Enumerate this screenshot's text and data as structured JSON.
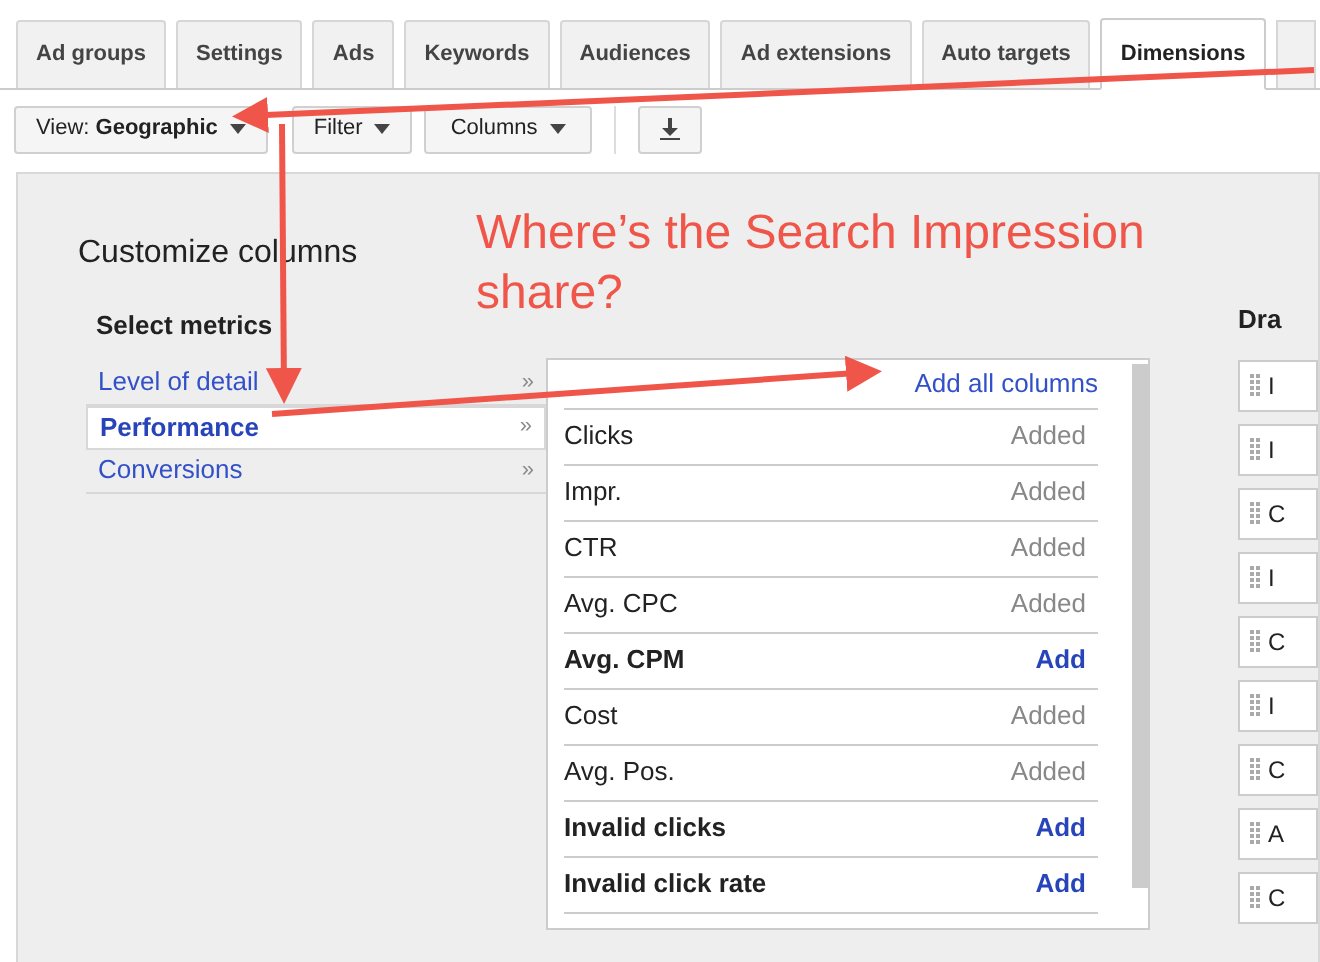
{
  "tabs": [
    {
      "label": "Ad groups",
      "selected": false
    },
    {
      "label": "Settings",
      "selected": false
    },
    {
      "label": "Ads",
      "selected": false
    },
    {
      "label": "Keywords",
      "selected": false
    },
    {
      "label": "Audiences",
      "selected": false
    },
    {
      "label": "Ad extensions",
      "selected": false
    },
    {
      "label": "Auto targets",
      "selected": false
    },
    {
      "label": "Dimensions",
      "selected": true
    }
  ],
  "toolbar": {
    "view_label": "View:",
    "view_value": "Geographic",
    "filter": "Filter",
    "columns": "Columns"
  },
  "panel": {
    "title": "Customize columns",
    "section_title": "Select metrics",
    "categories": [
      {
        "label": "Level of detail",
        "selected": false,
        "chevron": "»"
      },
      {
        "label": "Performance",
        "selected": true,
        "chevron": "»"
      },
      {
        "label": "Conversions",
        "selected": false,
        "chevron": "»"
      }
    ],
    "add_all": "Add all columns",
    "metrics": [
      {
        "name": "Clicks",
        "added": true,
        "action": "Added"
      },
      {
        "name": "Impr.",
        "added": true,
        "action": "Added"
      },
      {
        "name": "CTR",
        "added": true,
        "action": "Added"
      },
      {
        "name": "Avg. CPC",
        "added": true,
        "action": "Added"
      },
      {
        "name": "Avg. CPM",
        "added": false,
        "action": "Add"
      },
      {
        "name": "Cost",
        "added": true,
        "action": "Added"
      },
      {
        "name": "Avg. Pos.",
        "added": true,
        "action": "Added"
      },
      {
        "name": "Invalid clicks",
        "added": false,
        "action": "Add"
      },
      {
        "name": "Invalid click rate",
        "added": false,
        "action": "Add"
      }
    ],
    "right_heading": "Dra",
    "right_items": [
      "I",
      "I",
      "C",
      "I",
      "C",
      "I",
      "C",
      "A",
      "C"
    ]
  },
  "annotation": {
    "text": "Where’s the Search Impression share?"
  }
}
